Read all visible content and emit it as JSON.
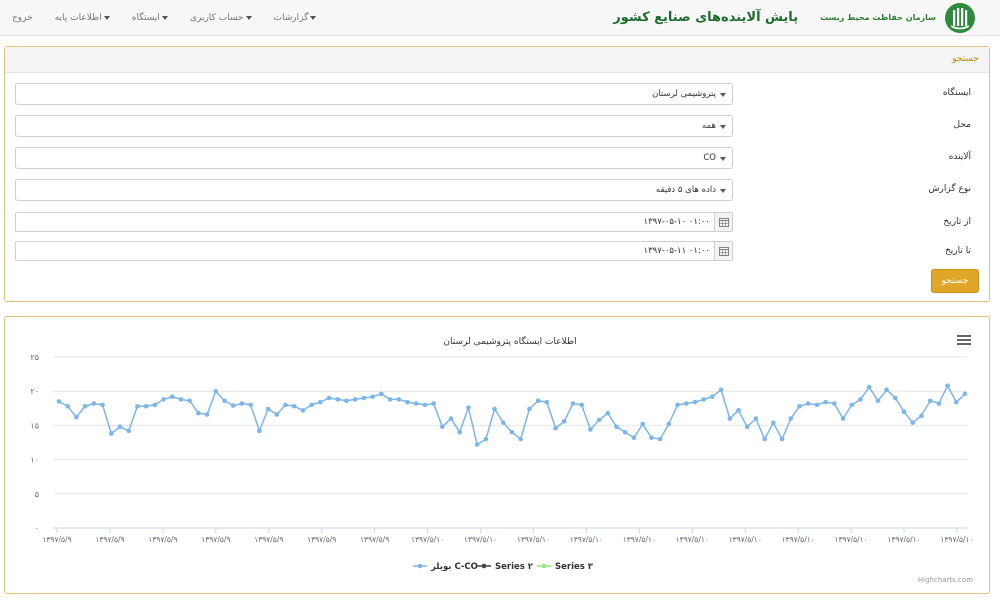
{
  "header": {
    "org_name": "سازمان حفاظت محیط زیست",
    "title": "پایش آلاینده‌های صنایع کشور",
    "menu": [
      {
        "label": "گزارشات",
        "caret": true
      },
      {
        "label": "حساب کاربری",
        "caret": true
      },
      {
        "label": "ایستگاه",
        "caret": true
      },
      {
        "label": "اطلاعات پایه",
        "caret": true
      },
      {
        "label": "خروج",
        "caret": false
      }
    ]
  },
  "search": {
    "heading": "جستجو",
    "fields": [
      {
        "label": "ایستگاه",
        "value": "پتروشیمی لرستان",
        "type": "select"
      },
      {
        "label": "محل",
        "value": "همه",
        "type": "select"
      },
      {
        "label": "آلاینده",
        "value": "CO",
        "type": "select"
      },
      {
        "label": "نوع گزارش",
        "value": "داده های ۵ دقیقه",
        "type": "select"
      },
      {
        "label": "از تاریخ",
        "value": "۱۳۹۷-۰۵-۱۰ ۰۱:۰۰",
        "type": "date"
      },
      {
        "label": "تا تاریخ",
        "value": "۱۳۹۷-۰۵-۱۱ ۰۱:۰۰",
        "type": "date"
      }
    ],
    "button_label": "جستجو"
  },
  "chart_data": {
    "type": "line",
    "title": "اطلاعات ایستگاه پتروشیمی لرستان",
    "ylim": [
      0,
      25
    ],
    "yticks": [
      "۰",
      "۵",
      "۱۰",
      "۱۵",
      "۲۰",
      "۲۵"
    ],
    "ytick_values": [
      0,
      5,
      10,
      15,
      20,
      25
    ],
    "xtick_labels": [
      "۱۳۹۷/۵/۹",
      "۱۳۹۷/۵/۹",
      "۱۳۹۷/۵/۹",
      "۱۳۹۷/۵/۹",
      "۱۳۹۷/۵/۹",
      "۱۳۹۷/۵/۹",
      "۱۳۹۷/۵/۹",
      "۱۳۹۷/۵/۱۰",
      "۱۳۹۷/۵/۱۰",
      "۱۳۹۷/۵/۱۰",
      "۱۳۹۷/۵/۱۰",
      "۱۳۹۷/۵/۱۰",
      "۱۳۹۷/۵/۱۰",
      "۱۳۹۷/۵/۱۰",
      "۱۳۹۷/۵/۱۰",
      "۱۳۹۷/۵/۱۰",
      "۱۳۹۷/۵/۱۰",
      "۱۳۹۷/۵/۱۰"
    ],
    "grid": true,
    "legend_position": "bottom-center",
    "series": [
      {
        "name": "بویلر C-CO",
        "color": "#7cb5ec",
        "values": [
          18.5,
          17.8,
          16.2,
          17.8,
          18.2,
          18.0,
          13.8,
          14.8,
          14.2,
          17.8,
          17.8,
          18.0,
          18.8,
          19.2,
          18.8,
          18.6,
          16.8,
          16.6,
          20.0,
          18.6,
          17.9,
          18.2,
          18.0,
          14.2,
          17.4,
          16.6,
          18.0,
          17.8,
          17.2,
          18.0,
          18.4,
          19.0,
          18.8,
          18.6,
          18.8,
          19.0,
          19.2,
          19.6,
          18.8,
          18.8,
          18.4,
          18.2,
          18.0,
          18.2,
          14.8,
          16.0,
          14.0,
          17.6,
          12.2,
          13.0,
          17.4,
          15.4,
          14.0,
          13.0,
          17.4,
          18.6,
          18.4,
          14.6,
          15.6,
          18.2,
          18.0,
          14.4,
          15.8,
          16.8,
          14.8,
          14.0,
          13.2,
          15.2,
          13.2,
          13.0,
          15.2,
          18.0,
          18.2,
          18.4,
          18.8,
          19.2,
          20.2,
          16.0,
          17.2,
          14.8,
          16.0,
          13.0,
          15.4,
          13.0,
          16.0,
          17.8,
          18.2,
          18.0,
          18.4,
          18.2,
          16.0,
          18.0,
          18.8,
          20.6,
          18.6,
          20.2,
          19.0,
          17.0,
          15.4,
          16.4,
          18.6,
          18.2,
          20.8,
          18.4,
          19.6
        ]
      },
      {
        "name": "Series ۲",
        "color": "#434348",
        "values": []
      },
      {
        "name": "Series ۳",
        "color": "#90ed7d",
        "values": []
      }
    ],
    "credit": "Highcharts.com"
  }
}
